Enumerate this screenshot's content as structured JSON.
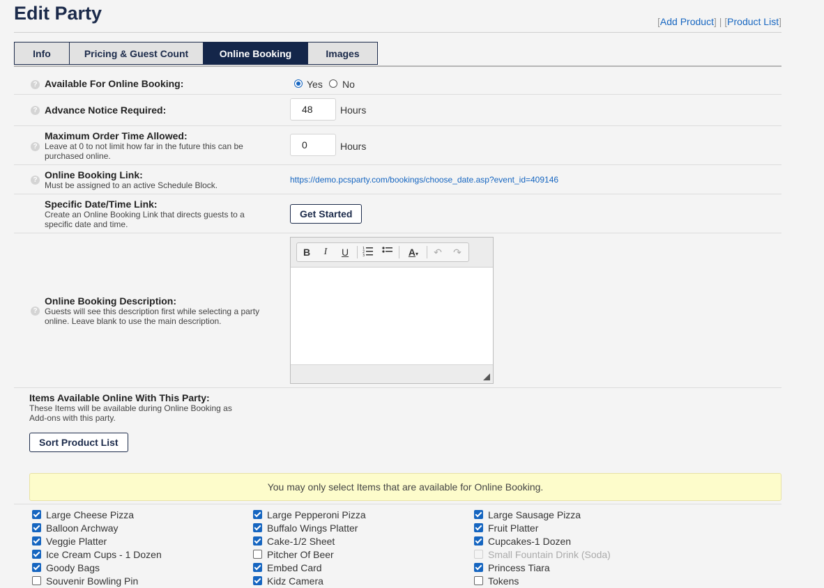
{
  "header": {
    "title": "Edit Party",
    "links": {
      "add_product": "Add Product",
      "product_list": "Product List",
      "bracket_open": "[",
      "bracket_close": "]",
      "separator": "|"
    }
  },
  "tabs": [
    {
      "label": "Info",
      "active": false
    },
    {
      "label": "Pricing & Guest Count",
      "active": false
    },
    {
      "label": "Online Booking",
      "active": true
    },
    {
      "label": "Images",
      "active": false
    }
  ],
  "form": {
    "available": {
      "label": "Available For Online Booking:",
      "yes": "Yes",
      "no": "No",
      "selected": "Yes"
    },
    "advance": {
      "label": "Advance Notice Required:",
      "value": "48",
      "unit": "Hours"
    },
    "max_order": {
      "label": "Maximum Order Time Allowed:",
      "help": "Leave at 0 to not limit how far in the future this can be purchased online.",
      "value": "0",
      "unit": "Hours"
    },
    "booking_link": {
      "label": "Online Booking Link:",
      "help": "Must be assigned to an active Schedule Block.",
      "url": "https://demo.pcsparty.com/bookings/choose_date.asp?event_id=409146"
    },
    "specific_link": {
      "label": "Specific Date/Time Link:",
      "help": "Create an Online Booking Link that directs guests to a specific date and time.",
      "button": "Get Started"
    },
    "description": {
      "label": "Online Booking Description:",
      "help": "Guests will see this description first while selecting a party online. Leave blank to use the main description.",
      "toolbar": [
        "B",
        "I",
        "U",
        "ordered-list",
        "bullet-list",
        "A",
        "undo",
        "redo"
      ]
    },
    "items_section": {
      "label": "Items Available Online With This Party:",
      "help": "These Items will be available during Online Booking as Add-ons with this party.",
      "button": "Sort Product List"
    },
    "icon_glyph": "?"
  },
  "notice": "You may only select Items that are available for Online Booking.",
  "items": [
    {
      "label": "Large Cheese Pizza",
      "state": "checked"
    },
    {
      "label": "Large Pepperoni Pizza",
      "state": "checked"
    },
    {
      "label": "Large Sausage Pizza",
      "state": "checked"
    },
    {
      "label": "Balloon Archway",
      "state": "checked"
    },
    {
      "label": "Buffalo Wings Platter",
      "state": "checked"
    },
    {
      "label": "Fruit Platter",
      "state": "checked"
    },
    {
      "label": "Veggie Platter",
      "state": "checked"
    },
    {
      "label": "Cake-1/2 Sheet",
      "state": "checked"
    },
    {
      "label": "Cupcakes-1 Dozen",
      "state": "checked"
    },
    {
      "label": "Ice Cream Cups - 1 Dozen",
      "state": "checked"
    },
    {
      "label": "Pitcher Of Beer",
      "state": "unchecked"
    },
    {
      "label": "Small Fountain Drink (Soda)",
      "state": "disabled"
    },
    {
      "label": "Goody Bags",
      "state": "checked"
    },
    {
      "label": "Embed Card",
      "state": "checked"
    },
    {
      "label": "Princess Tiara",
      "state": "checked"
    },
    {
      "label": "Souvenir Bowling Pin",
      "state": "unchecked"
    },
    {
      "label": "Kidz Camera",
      "state": "checked"
    },
    {
      "label": "Tokens",
      "state": "unchecked"
    }
  ],
  "colors": {
    "navy": "#14264a",
    "link": "#1565c0",
    "notice_bg": "#fdfccb"
  }
}
